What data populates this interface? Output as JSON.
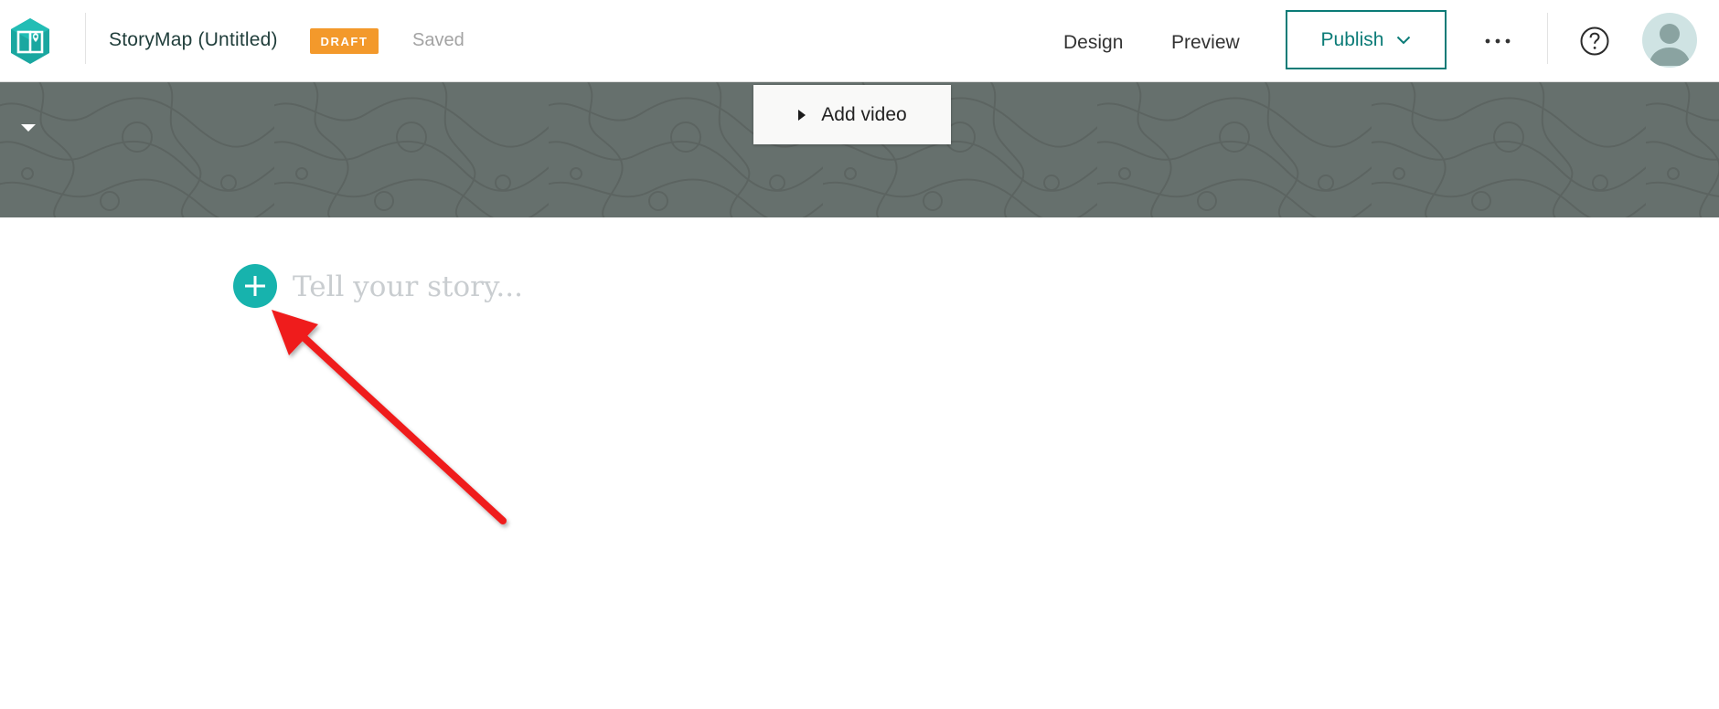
{
  "header": {
    "story_title": "StoryMap (Untitled)",
    "status_badge": "DRAFT",
    "save_status": "Saved",
    "nav": {
      "design": "Design",
      "preview": "Preview"
    },
    "publish_label": "Publish"
  },
  "cover": {
    "add_video_label": "Add video"
  },
  "editor": {
    "placeholder": "Tell your story..."
  },
  "icons": {
    "logo": "storymaps-logo-icon",
    "publish_menu": "chevron-down-icon",
    "more": "more-options-icon",
    "help": "help-icon",
    "user": "avatar-icon",
    "cover_toggle": "caret-down-icon",
    "add_video": "play-triangle-icon",
    "add_block": "plus-icon",
    "annotation": "red-arrow-annotation"
  },
  "colors": {
    "accent": "#0b7b77",
    "add_button": "#17b3ad",
    "draft_badge": "#f3992b",
    "cover_background": "#66706d",
    "annotation_arrow": "#ef1b1b"
  }
}
